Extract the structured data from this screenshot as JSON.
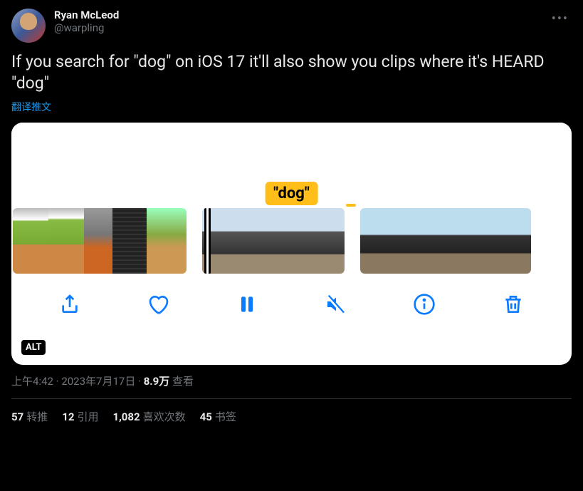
{
  "author": {
    "display_name": "Ryan McLeod",
    "handle": "@warpling"
  },
  "tweet_text": "If you search for \"dog\" on iOS 17 it'll also show you clips where it's HEARD \"dog\"",
  "translate_label": "翻译推文",
  "media": {
    "badge_text": "\"dog\"",
    "alt_label": "ALT"
  },
  "meta": {
    "time": "上午4:42",
    "date": "2023年7月17日",
    "views_number": "8.9万",
    "views_label": "查看",
    "separator": " · "
  },
  "stats": {
    "retweets_num": "57",
    "retweets_label": "转推",
    "quotes_num": "12",
    "quotes_label": "引用",
    "likes_num": "1,082",
    "likes_label": "喜欢次数",
    "bookmarks_num": "45",
    "bookmarks_label": "书签"
  }
}
